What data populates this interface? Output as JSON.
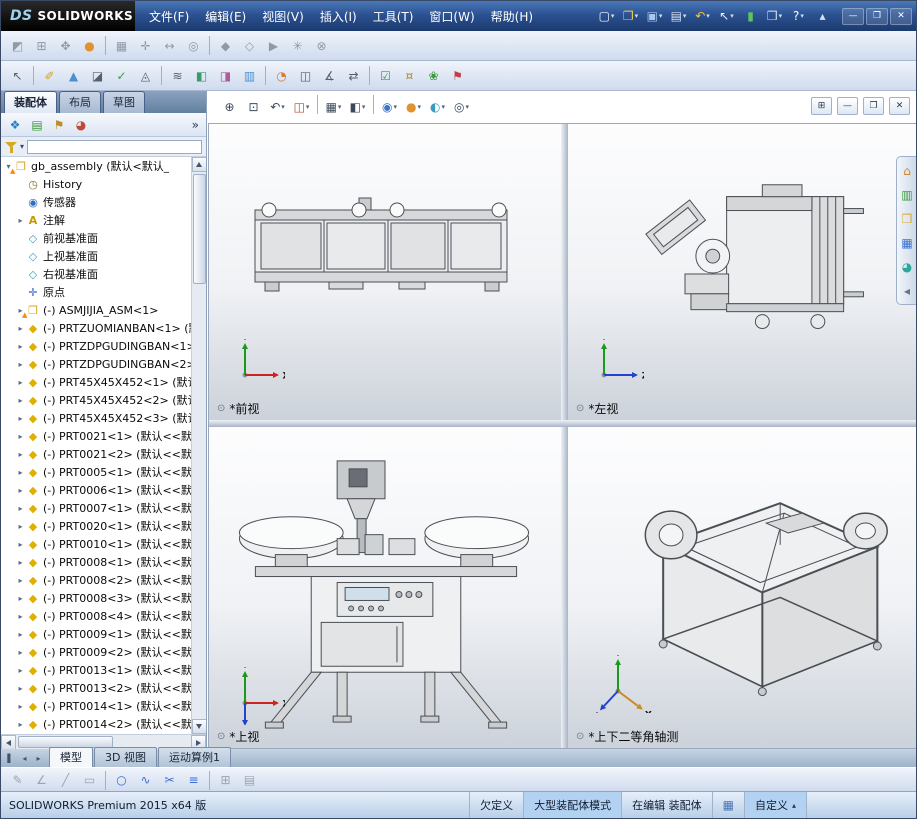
{
  "ui": {
    "dropdown_arrow": "▾",
    "view_indicator": "⊙"
  },
  "titlebar": {
    "logo_ds": "DS",
    "logo_text": "SOLIDWORKS",
    "menus": [
      "文件(F)",
      "编辑(E)",
      "视图(V)",
      "插入(I)",
      "工具(T)",
      "窗口(W)",
      "帮助(H)"
    ],
    "icons": [
      {
        "name": "new-document-icon",
        "glyph": "▢",
        "color": "#f4f8ff",
        "dropdown": true
      },
      {
        "name": "open-icon",
        "glyph": "❐",
        "color": "#f2cf4a",
        "dropdown": true
      },
      {
        "name": "save-icon",
        "glyph": "▣",
        "color": "#a8c8f0",
        "dropdown": true
      },
      {
        "name": "print-icon",
        "glyph": "▤",
        "color": "#d6e0f0",
        "dropdown": true
      },
      {
        "name": "undo-icon",
        "glyph": "↶",
        "color": "#f0c43a",
        "dropdown": true
      },
      {
        "name": "select-icon",
        "glyph": "↖",
        "color": "#eef2fa",
        "dropdown": true
      },
      {
        "name": "rebuild-icon",
        "glyph": "▮",
        "color": "#5ec45e",
        "dropdown": false
      },
      {
        "name": "options-icon",
        "glyph": "❒",
        "color": "#d6e0f0",
        "dropdown": true
      },
      {
        "name": "help-icon",
        "glyph": "?",
        "color": "#ffffff",
        "dropdown": true
      },
      {
        "name": "collapse-ribbon-icon",
        "glyph": "▴",
        "color": "#d6e0f0",
        "dropdown": false
      }
    ],
    "window_buttons": [
      {
        "name": "minimize-icon",
        "glyph": "—",
        "color": "#ffffff"
      },
      {
        "name": "maximize-icon",
        "glyph": "❐",
        "color": "#ffffff"
      },
      {
        "name": "close-icon",
        "glyph": "✕",
        "color": "#ffffff"
      }
    ]
  },
  "toolbars": {
    "row1": [
      {
        "name": "edit-component-icon",
        "glyph": "◩",
        "color": "#8f9aa8"
      },
      {
        "name": "insert-components-icon",
        "glyph": "⊞",
        "color": "#8f9aa8"
      },
      {
        "name": "mate-icon",
        "glyph": "✥",
        "color": "#8f9aa8"
      },
      {
        "name": "appearance-ball-icon",
        "glyph": "●",
        "color": "#e0922e"
      },
      {
        "sep": true
      },
      {
        "name": "linear-component-pattern-icon",
        "glyph": "▦",
        "color": "#8f9aa8"
      },
      {
        "name": "smart-fasteners-icon",
        "glyph": "✛",
        "color": "#8f9aa8"
      },
      {
        "name": "move-component-icon",
        "glyph": "↔",
        "color": "#8f9aa8"
      },
      {
        "name": "show-hidden-components-icon",
        "glyph": "◎",
        "color": "#8f9aa8"
      },
      {
        "sep": true
      },
      {
        "name": "assembly-features-icon",
        "glyph": "◆",
        "color": "#8f9aa8"
      },
      {
        "name": "reference-geometry-icon",
        "glyph": "◇",
        "color": "#8f9aa8"
      },
      {
        "name": "new-motion-study-icon",
        "glyph": "▶",
        "color": "#8f9aa8"
      },
      {
        "name": "exploded-view-icon",
        "glyph": "✳",
        "color": "#8f9aa8"
      },
      {
        "name": "interference-detection-icon",
        "glyph": "⊗",
        "color": "#8f9aa8"
      }
    ],
    "row2": [
      {
        "name": "select-arrow-icon",
        "glyph": "↖",
        "color": "#55606e"
      },
      {
        "sep": true
      },
      {
        "name": "measure-icon",
        "glyph": "✐",
        "color": "#d8a020"
      },
      {
        "name": "mass-properties-icon",
        "glyph": "▲",
        "color": "#4a90d0"
      },
      {
        "name": "section-properties-icon",
        "glyph": "◪",
        "color": "#55606e"
      },
      {
        "name": "check-icon",
        "glyph": "✓",
        "color": "#3aa03a"
      },
      {
        "name": "geometry-analysis-icon",
        "glyph": "◬",
        "color": "#55606e"
      },
      {
        "sep": true
      },
      {
        "name": "zebra-stripes-icon",
        "glyph": "≋",
        "color": "#55606e"
      },
      {
        "name": "draft-analysis-icon",
        "glyph": "◧",
        "color": "#3a9a6a"
      },
      {
        "name": "undercut-analysis-icon",
        "glyph": "◨",
        "color": "#b05a9a"
      },
      {
        "name": "thickness-analysis-icon",
        "glyph": "▥",
        "color": "#4a90d0"
      },
      {
        "sep": true
      },
      {
        "name": "curvature-icon",
        "glyph": "◔",
        "color": "#d87a2a"
      },
      {
        "name": "symmetry-check-icon",
        "glyph": "◫",
        "color": "#55606e"
      },
      {
        "name": "deviation-analysis-icon",
        "glyph": "∡",
        "color": "#55606e"
      },
      {
        "name": "compare-documents-icon",
        "glyph": "⇄",
        "color": "#55606e"
      },
      {
        "sep": true
      },
      {
        "name": "design-checker-icon",
        "glyph": "☑",
        "color": "#3aa03a"
      },
      {
        "name": "costing-icon",
        "glyph": "¤",
        "color": "#b08a2a"
      },
      {
        "name": "sustainability-icon",
        "glyph": "❀",
        "color": "#3a9a3a"
      },
      {
        "name": "simulationxpress-icon",
        "glyph": "⚑",
        "color": "#c04040"
      }
    ]
  },
  "hud": {
    "icons": [
      {
        "name": "zoom-to-fit-icon",
        "glyph": "⊕",
        "color": "#3a4a5e"
      },
      {
        "name": "zoom-to-area-icon",
        "glyph": "⊡",
        "color": "#3a4a5e"
      },
      {
        "name": "previous-view-icon",
        "glyph": "↶",
        "color": "#3a4a5e",
        "dropdown": true
      },
      {
        "name": "section-view-icon",
        "glyph": "◫",
        "color": "#b04a3a",
        "dropdown": true
      },
      {
        "sep": true
      },
      {
        "name": "view-orientation-icon",
        "glyph": "▦",
        "color": "#3a4a5e",
        "dropdown": true
      },
      {
        "name": "display-style-icon",
        "glyph": "◧",
        "color": "#3a4a5e",
        "dropdown": true
      },
      {
        "sep": true
      },
      {
        "name": "hide-show-items-icon",
        "glyph": "◉",
        "color": "#3a76c4",
        "dropdown": true
      },
      {
        "name": "edit-appearance-icon",
        "glyph": "●",
        "color": "#e0922e",
        "dropdown": true
      },
      {
        "name": "apply-scene-icon",
        "glyph": "◐",
        "color": "#3a9ac4",
        "dropdown": true
      },
      {
        "name": "view-settings-icon",
        "glyph": "◎",
        "color": "#3a4a5e",
        "dropdown": true
      }
    ],
    "window_controls": [
      {
        "name": "viewport-layout-icon",
        "glyph": "⊞",
        "color": "#2a3a52"
      },
      {
        "name": "doc-minimize-icon",
        "glyph": "—",
        "color": "#2a3a52"
      },
      {
        "name": "doc-restore-icon",
        "glyph": "❐",
        "color": "#2a3a52"
      },
      {
        "name": "doc-close-icon",
        "glyph": "✕",
        "color": "#2a3a52"
      }
    ]
  },
  "feature_panel": {
    "command_tabs": [
      {
        "label": "装配体",
        "active": true
      },
      {
        "label": "布局",
        "active": false
      },
      {
        "label": "草图",
        "active": false
      }
    ],
    "toolbar_icons": [
      {
        "name": "featuremanager-tree-tab-icon",
        "glyph": "❖",
        "color": "#2a7fbf"
      },
      {
        "name": "propertymanager-tab-icon",
        "glyph": "▤",
        "color": "#3a9a3a"
      },
      {
        "name": "configurationmanager-tab-icon",
        "glyph": "⚑",
        "color": "#c08a2a"
      },
      {
        "name": "displaymanager-tab-icon",
        "glyph": "◕",
        "color": "#c04a3a"
      }
    ],
    "chevron": "»"
  },
  "tree": {
    "icon_map": {
      "assembly": {
        "glyph": "❒",
        "color": "#d9a520"
      },
      "history": {
        "glyph": "◷",
        "color": "#8a6d2f"
      },
      "sensor": {
        "glyph": "◉",
        "color": "#2f6fbf"
      },
      "annotation": {
        "glyph": "A",
        "color": "#c99700"
      },
      "plane": {
        "glyph": "◇",
        "color": "#3f9fc0"
      },
      "origin": {
        "glyph": "✛",
        "color": "#3060c0"
      },
      "part": {
        "glyph": "◆",
        "color": "#e0b000"
      }
    },
    "items": [
      {
        "t": "assembly",
        "label": "gb_assembly (默认<默认_",
        "arrow": "down",
        "warn": true,
        "indent": 0
      },
      {
        "t": "history",
        "label": "History",
        "arrow": "none",
        "indent": 1
      },
      {
        "t": "sensor",
        "label": "传感器",
        "arrow": "none",
        "indent": 1
      },
      {
        "t": "annotation",
        "label": "注解",
        "arrow": "right",
        "indent": 1
      },
      {
        "t": "plane",
        "label": "前视基准面",
        "arrow": "none",
        "indent": 1
      },
      {
        "t": "plane",
        "label": "上视基准面",
        "arrow": "none",
        "indent": 1
      },
      {
        "t": "plane",
        "label": "右视基准面",
        "arrow": "none",
        "indent": 1
      },
      {
        "t": "origin",
        "label": "原点",
        "arrow": "none",
        "indent": 1
      },
      {
        "t": "assembly",
        "label": "(-) ASMJIJIA_ASM<1>",
        "arrow": "right",
        "warn": true,
        "indent": 1
      },
      {
        "t": "part",
        "label": "(-) PRTZUOMIANBAN<1> (默",
        "arrow": "right",
        "indent": 1
      },
      {
        "t": "part",
        "label": "(-) PRTZDPGUDINGBAN<1>",
        "arrow": "right",
        "indent": 1
      },
      {
        "t": "part",
        "label": "(-) PRTZDPGUDINGBAN<2>",
        "arrow": "right",
        "indent": 1
      },
      {
        "t": "part",
        "label": "(-) PRT45X45X452<1> (默认",
        "arrow": "right",
        "indent": 1
      },
      {
        "t": "part",
        "label": "(-) PRT45X45X452<2> (默认",
        "arrow": "right",
        "indent": 1
      },
      {
        "t": "part",
        "label": "(-) PRT45X45X452<3> (默认",
        "arrow": "right",
        "indent": 1
      },
      {
        "t": "part",
        "label": "(-) PRT0021<1> (默认<<默",
        "arrow": "right",
        "indent": 1
      },
      {
        "t": "part",
        "label": "(-) PRT0021<2> (默认<<默",
        "arrow": "right",
        "indent": 1
      },
      {
        "t": "part",
        "label": "(-) PRT0005<1> (默认<<默",
        "arrow": "right",
        "indent": 1
      },
      {
        "t": "part",
        "label": "(-) PRT0006<1> (默认<<默",
        "arrow": "right",
        "indent": 1
      },
      {
        "t": "part",
        "label": "(-) PRT0007<1> (默认<<默",
        "arrow": "right",
        "indent": 1
      },
      {
        "t": "part",
        "label": "(-) PRT0020<1> (默认<<默",
        "arrow": "right",
        "indent": 1
      },
      {
        "t": "part",
        "label": "(-) PRT0010<1> (默认<<默",
        "arrow": "right",
        "indent": 1
      },
      {
        "t": "part",
        "label": "(-) PRT0008<1> (默认<<默",
        "arrow": "right",
        "indent": 1
      },
      {
        "t": "part",
        "label": "(-) PRT0008<2> (默认<<默",
        "arrow": "right",
        "indent": 1
      },
      {
        "t": "part",
        "label": "(-) PRT0008<3> (默认<<默",
        "arrow": "right",
        "indent": 1
      },
      {
        "t": "part",
        "label": "(-) PRT0008<4> (默认<<默",
        "arrow": "right",
        "indent": 1
      },
      {
        "t": "part",
        "label": "(-) PRT0009<1> (默认<<默",
        "arrow": "right",
        "indent": 1
      },
      {
        "t": "part",
        "label": "(-) PRT0009<2> (默认<<默",
        "arrow": "right",
        "indent": 1
      },
      {
        "t": "part",
        "label": "(-) PRT0013<1> (默认<<默",
        "arrow": "right",
        "indent": 1
      },
      {
        "t": "part",
        "label": "(-) PRT0013<2> (默认<<默",
        "arrow": "right",
        "indent": 1
      },
      {
        "t": "part",
        "label": "(-) PRT0014<1> (默认<<默",
        "arrow": "right",
        "indent": 1
      },
      {
        "t": "part",
        "label": "(-) PRT0014<2> (默认<<默",
        "arrow": "right",
        "indent": 1
      }
    ]
  },
  "viewports": [
    {
      "label": "*前视",
      "triad": [
        {
          "dir": "up",
          "letter": "Y",
          "color": "#1a9a1a"
        },
        {
          "dir": "right",
          "letter": "X",
          "color": "#cc2222"
        }
      ]
    },
    {
      "label": "*左视",
      "triad": [
        {
          "dir": "up",
          "letter": "Y",
          "color": "#1a9a1a"
        },
        {
          "dir": "right",
          "letter": "Z",
          "color": "#2244cc"
        }
      ]
    },
    {
      "label": "*上视",
      "triad": [
        {
          "dir": "up",
          "letter": "Y",
          "color": "#1a9a1a"
        },
        {
          "dir": "right",
          "letter": "X",
          "color": "#cc2222"
        },
        {
          "dir": "down",
          "letter": "Z",
          "color": "#2244cc"
        }
      ]
    },
    {
      "label": "*上下二等角轴测",
      "triad": [
        {
          "dir": "up",
          "letter": "Y",
          "color": "#1a9a1a"
        },
        {
          "dir": "downright",
          "letter": "X",
          "color": "#cc8a22"
        },
        {
          "dir": "downleft",
          "letter": "Z",
          "color": "#2244cc"
        }
      ]
    }
  ],
  "task_pane": {
    "icons": [
      {
        "name": "resources-tab-icon",
        "glyph": "⌂",
        "color": "#d0862a"
      },
      {
        "name": "design-library-tab-icon",
        "glyph": "▥",
        "color": "#3a9a3a"
      },
      {
        "name": "file-explorer-tab-icon",
        "glyph": "❒",
        "color": "#d8a82a"
      },
      {
        "name": "view-palette-tab-icon",
        "glyph": "▦",
        "color": "#3a6fd0"
      },
      {
        "name": "appearances-tab-icon",
        "glyph": "◕",
        "color": "#2aa89a"
      },
      {
        "name": "custom-properties-tab-icon",
        "glyph": "◂",
        "color": "#6a7686"
      }
    ]
  },
  "bottom_bar": {
    "nav": [
      {
        "name": "tab-splitter-icon",
        "glyph": "▌",
        "color": "#44536b"
      },
      {
        "name": "tab-scroll-left-icon",
        "glyph": "◂",
        "color": "#44536b"
      },
      {
        "name": "tab-scroll-right-icon",
        "glyph": "▸",
        "color": "#44536b"
      }
    ],
    "tabs": [
      {
        "label": "模型",
        "active": true
      },
      {
        "label": "3D 视图",
        "active": false
      },
      {
        "label": "运动算例1",
        "active": false
      }
    ]
  },
  "bottom_toolbar": {
    "icons": [
      {
        "name": "sketch-icon",
        "glyph": "✎",
        "color": "#9aa4b2"
      },
      {
        "name": "smart-dimension-icon",
        "glyph": "∠",
        "color": "#9aa4b2"
      },
      {
        "name": "line-icon",
        "glyph": "╱",
        "color": "#9aa4b2"
      },
      {
        "name": "rectangle-icon",
        "glyph": "▭",
        "color": "#9aa4b2"
      },
      {
        "sep": true
      },
      {
        "name": "circle-icon",
        "glyph": "○",
        "color": "#3a6fd0"
      },
      {
        "name": "spline-icon",
        "glyph": "∿",
        "color": "#3a6fd0"
      },
      {
        "name": "trim-entities-icon",
        "glyph": "✂",
        "color": "#3a6fd0"
      },
      {
        "name": "convert-entities-icon",
        "glyph": "≡",
        "color": "#3a6fd0"
      },
      {
        "sep": true
      },
      {
        "name": "offset-entities-icon",
        "glyph": "⊞",
        "color": "#9aa4b2"
      },
      {
        "name": "linear-sketch-pattern-icon",
        "glyph": "▤",
        "color": "#9aa4b2"
      }
    ]
  },
  "status": {
    "left_text": "SOLIDWORKS Premium 2015 x64 版",
    "segments": [
      {
        "name": "status-underdefined",
        "label": "欠定义",
        "highlight": false
      },
      {
        "name": "status-large-assembly-mode",
        "label": "大型装配体模式",
        "highlight": true
      },
      {
        "name": "status-editing-assembly",
        "label": "在编辑 装配体",
        "highlight": false
      },
      {
        "name": "status-quick-tips",
        "label": "",
        "icon": "▦",
        "icon_name": "quick-tips-icon",
        "highlight": false
      },
      {
        "name": "status-customize",
        "label": "自定义",
        "caret": "▴",
        "highlight": true
      },
      {
        "name": "status-blank",
        "label": "",
        "highlight": false,
        "blank": true
      }
    ]
  }
}
